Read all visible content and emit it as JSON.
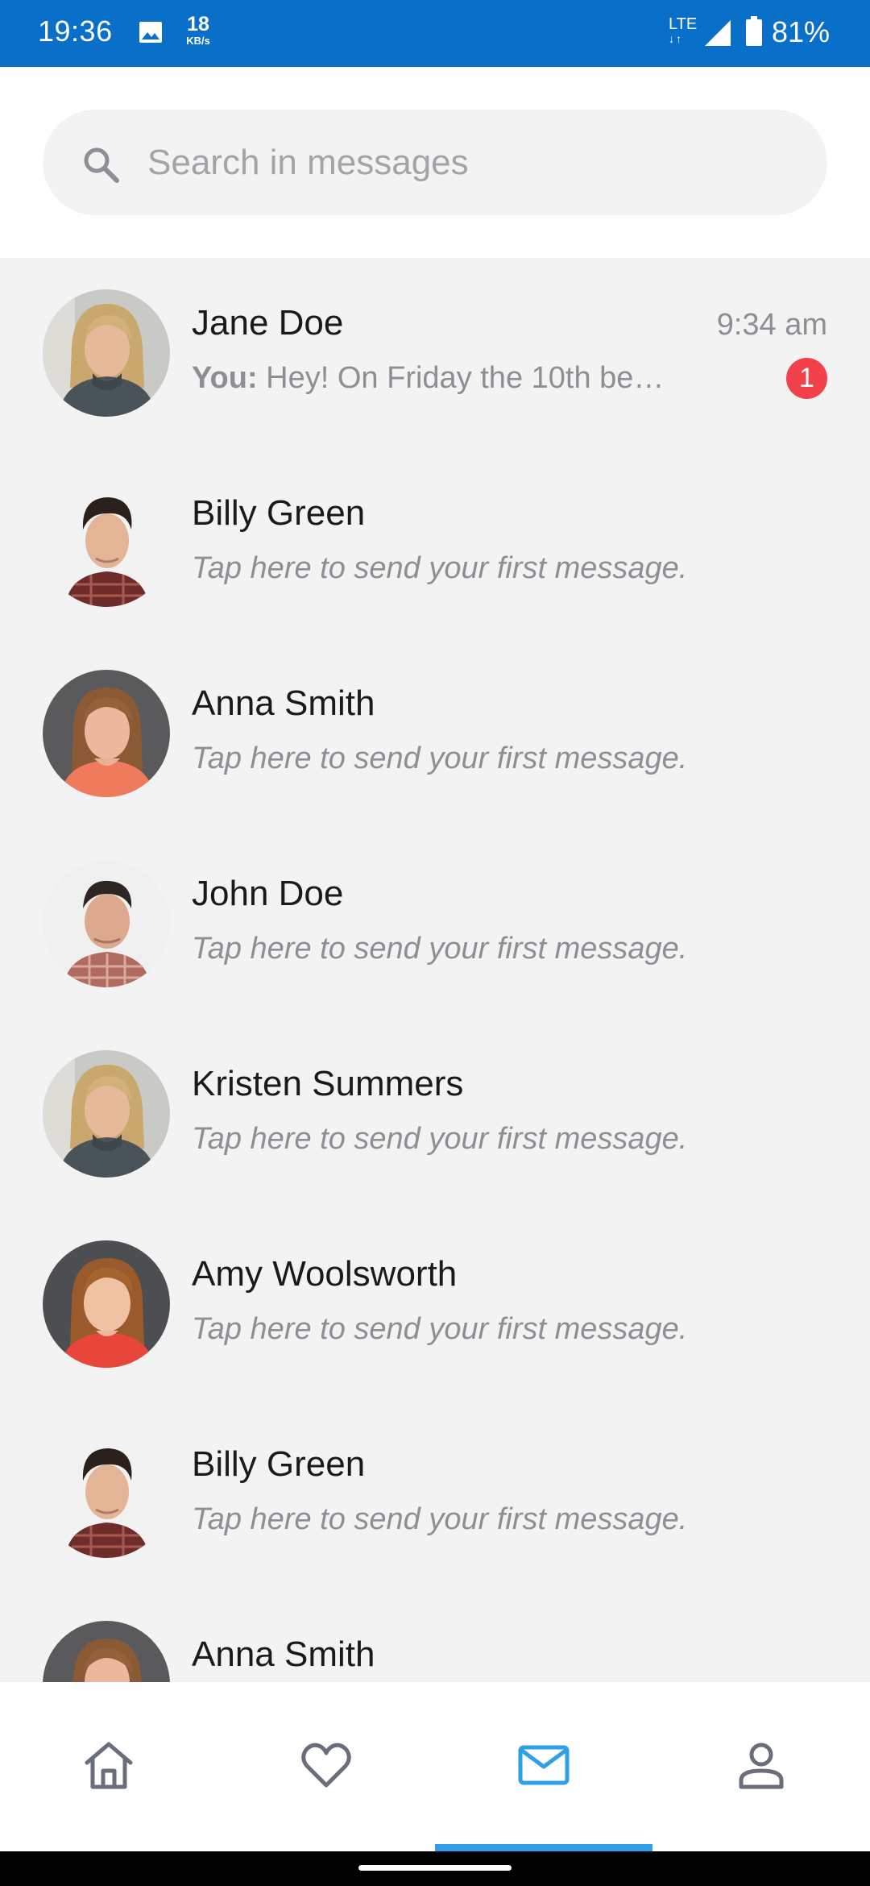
{
  "status_bar": {
    "time": "19:36",
    "net_speed": "18",
    "net_unit": "KB/s",
    "network": "LTE",
    "battery": "81%"
  },
  "search": {
    "placeholder": "Search in messages"
  },
  "conversations": [
    {
      "name": "Jane Doe",
      "sender": "You:",
      "preview": "Hey! On Friday the 10th be…",
      "time": "9:34 am",
      "unread": "1"
    },
    {
      "name": "Billy Green",
      "preview": "Tap here to send your first message."
    },
    {
      "name": "Anna Smith",
      "preview": "Tap here to send your first message."
    },
    {
      "name": "John Doe",
      "preview": "Tap here to send your first message."
    },
    {
      "name": "Kristen Summers",
      "preview": "Tap here to send your first message."
    },
    {
      "name": "Amy Woolsworth",
      "preview": "Tap here to send your first message."
    },
    {
      "name": "Billy Green",
      "preview": "Tap here to send your first message."
    },
    {
      "name": "Anna Smith",
      "preview": ""
    }
  ],
  "bottom_nav": {
    "items": [
      {
        "icon": "home-icon"
      },
      {
        "icon": "heart-icon"
      },
      {
        "icon": "mail-icon",
        "active": true
      },
      {
        "icon": "profile-icon"
      }
    ]
  },
  "colors": {
    "status_bar": "#0a6fc9",
    "accent": "#2e9fe8",
    "badge": "#f2414a",
    "nav_icon": "#6a6d7c"
  }
}
